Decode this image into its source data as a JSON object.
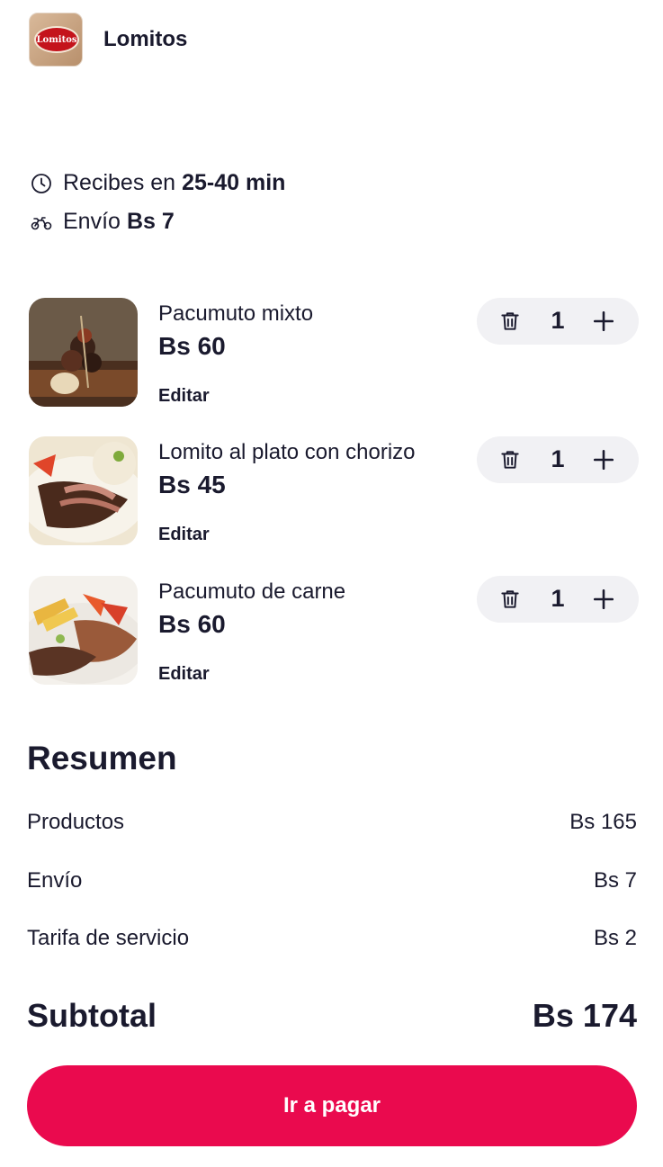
{
  "store": {
    "name": "Lomitos",
    "logo_text": "Lomitos"
  },
  "delivery": {
    "time_prefix": "Recibes en",
    "time_value": "25-40 min",
    "shipping_prefix": "Envío",
    "shipping_value": "Bs 7"
  },
  "items": [
    {
      "name": "Pacumuto mixto",
      "price": "Bs 60",
      "edit_label": "Editar",
      "quantity": "1"
    },
    {
      "name": "Lomito al plato con chorizo",
      "price": "Bs 45",
      "edit_label": "Editar",
      "quantity": "1"
    },
    {
      "name": "Pacumuto de carne",
      "price": "Bs 60",
      "edit_label": "Editar",
      "quantity": "1"
    }
  ],
  "summary": {
    "title": "Resumen",
    "rows": [
      {
        "label": "Productos",
        "value": "Bs 165"
      },
      {
        "label": "Envío",
        "value": "Bs 7"
      },
      {
        "label": "Tarifa de servicio",
        "value": "Bs 2"
      }
    ],
    "subtotal_label": "Subtotal",
    "subtotal_value": "Bs 174"
  },
  "checkout": {
    "button_label": "Ir a pagar"
  },
  "colors": {
    "accent": "#ea0a4e",
    "text": "#1a1a2e",
    "stepper_bg": "#f1f1f4"
  }
}
